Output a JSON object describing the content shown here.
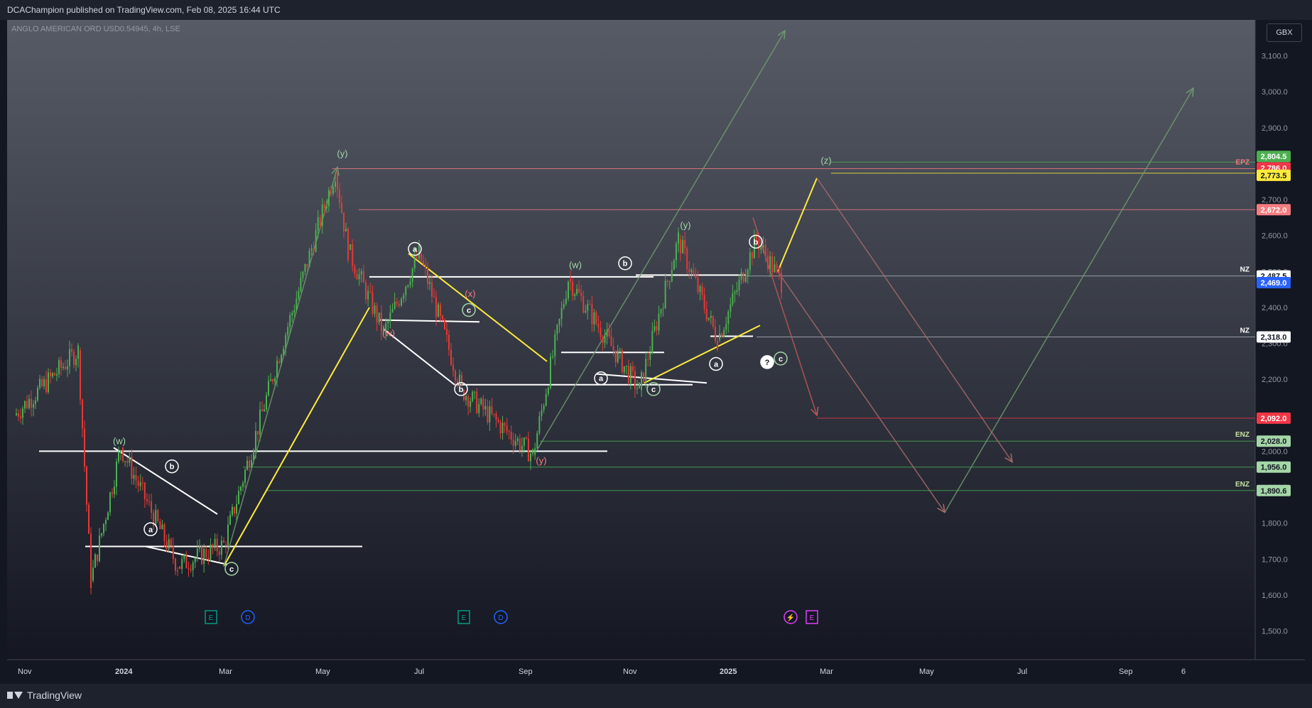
{
  "header": {
    "publisher_line": "DCAChampion published on TradingView.com, Feb 08, 2025 16:44 UTC"
  },
  "symbol": {
    "label": "ANGLO AMERICAN ORD USD0.54945, 4h, LSE"
  },
  "currency_button": "GBX",
  "footer": {
    "brand": "TradingView"
  },
  "chart_data": {
    "type": "line",
    "title": "ANGLO AMERICAN ORD USD0.54945, 4h, LSE",
    "price_axis": {
      "unit": "GBX",
      "ticks": [
        "3,100.0",
        "3,000.0",
        "2,900.0",
        "2,800.0",
        "2,700.0",
        "2,600.0",
        "2,500.0",
        "2,400.0",
        "2,300.0",
        "2,200.0",
        "2,100.0",
        "2,000.0",
        "1,900.0",
        "1,800.0",
        "1,700.0",
        "1,600.0",
        "1,500.0"
      ],
      "range": [
        1420,
        3200
      ]
    },
    "time_axis": {
      "ticks": [
        "Nov",
        "2024",
        "Mar",
        "May",
        "Jul",
        "Sep",
        "Nov",
        "2025",
        "Mar",
        "May",
        "Jul",
        "Sep",
        "6"
      ]
    },
    "price_series": {
      "name": "",
      "x": [
        "Nov 2023",
        "early Dec 2023",
        "Dec 2023",
        "Jan 2024",
        "Feb 2024",
        "Mar 2024",
        "Apr 2024",
        "May 2024",
        "May 2024",
        "Jun 2024",
        "Jul 2024",
        "Aug 2024",
        "Sep 2024",
        "Oct 2024",
        "Nov 2024",
        "Dec 2024",
        "Jan 2025",
        "Jan 2025",
        "Feb 2025"
      ],
      "values": [
        2100,
        2280,
        1640,
        2010,
        1680,
        1740,
        2250,
        2780,
        2560,
        2330,
        2550,
        2170,
        1990,
        2480,
        2170,
        2590,
        2310,
        2590,
        2470
      ]
    },
    "price_labels": [
      {
        "value": "2,804.5",
        "color": "#4caf50"
      },
      {
        "value": "2,786.0",
        "color": "#f23645"
      },
      {
        "value": "2,773.5",
        "color": "#ffeb3b"
      },
      {
        "value": "2,672.0",
        "color": "#f77c80"
      },
      {
        "value": "2,487.5",
        "color": "#ffffff"
      },
      {
        "value": "2,469.0",
        "color": "#2962ff"
      },
      {
        "value": "2,318.0",
        "color": "#ffffff"
      },
      {
        "value": "2,092.0",
        "color": "#f23645"
      },
      {
        "value": "2,028.0",
        "color": "#a5d6a7"
      },
      {
        "value": "1,956.0",
        "color": "#a5d6a7"
      },
      {
        "value": "1,890.6",
        "color": "#a5d6a7"
      }
    ],
    "zone_labels": [
      {
        "text": "EPZ",
        "price": 2786.0
      },
      {
        "text": "NZ",
        "price": 2487.5
      },
      {
        "text": "NZ",
        "price": 2318.0
      },
      {
        "text": "ENZ",
        "price": 2028.0
      },
      {
        "text": "ENZ",
        "price": 1890.6
      }
    ],
    "wave_labels": [
      "(w)",
      "(y)",
      "(x)",
      "(w)",
      "(y)",
      "(w)",
      "(y)",
      "(z)",
      "a",
      "b",
      "c",
      "a",
      "b",
      "c",
      "a",
      "b",
      "c",
      "a",
      "b",
      "c",
      "?",
      "a",
      "c",
      "b"
    ],
    "event_markers": [
      "E",
      "D",
      "E",
      "D",
      "⚡",
      "E"
    ],
    "grid": false,
    "legend": "none"
  }
}
